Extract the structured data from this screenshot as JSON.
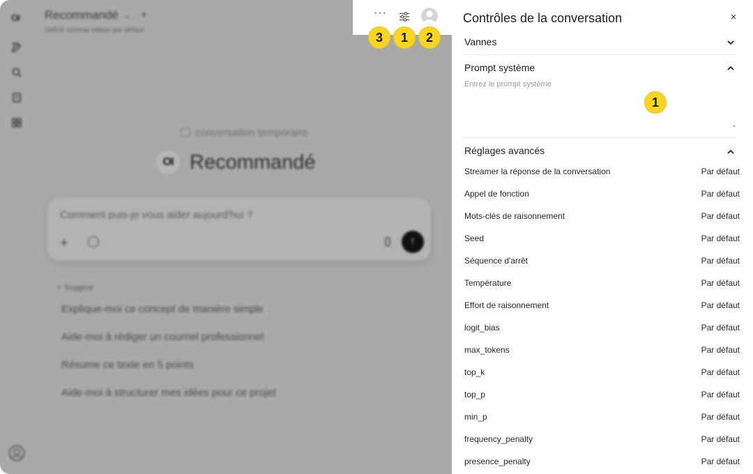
{
  "header": {
    "model_name": "Recommandé",
    "set_default": "Définir comme valeur par défaut"
  },
  "sidebar": {
    "logo": "OI",
    "icons": [
      "new-chat-icon",
      "search-icon",
      "notes-icon",
      "workspace-icon"
    ]
  },
  "chat": {
    "temporary_label": "conversation temporaire",
    "hero_logo": "OI",
    "hero_title": "Recommandé",
    "composer_placeholder": "Comment puis-je vous aider aujourd'hui ?",
    "suggested_heading": "✧ Suggéré",
    "suggestions": [
      "Explique-moi ce concept de manière simple",
      "Aide-moi à rédiger un courriel professionnel",
      "Résume ce texte en 5 points",
      "Aide-moi à structurer mes idées pour ce projet"
    ]
  },
  "toolbar": {
    "more_label": "···"
  },
  "badges": {
    "more": "3",
    "controls": "1",
    "profile": "2",
    "prompt": "1"
  },
  "panel": {
    "title": "Contrôles de la conversation",
    "close": "×",
    "sections": {
      "valves": "Vannes",
      "system_prompt": "Prompt système",
      "advanced": "Réglages avancés"
    },
    "system_prompt_placeholder": "Entrez le prompt système",
    "params": [
      {
        "name": "Streamer la réponse de la conversation",
        "value": "Par défaut"
      },
      {
        "name": "Appel de fonction",
        "value": "Par défaut"
      },
      {
        "name": "Mots-clés de raisonnement",
        "value": "Par défaut"
      },
      {
        "name": "Seed",
        "value": "Par défaut"
      },
      {
        "name": "Séquence d'arrêt",
        "value": "Par défaut"
      },
      {
        "name": "Température",
        "value": "Par défaut"
      },
      {
        "name": "Effort de raisonnement",
        "value": "Par défaut"
      },
      {
        "name": "logit_bias",
        "value": "Par défaut"
      },
      {
        "name": "max_tokens",
        "value": "Par défaut"
      },
      {
        "name": "top_k",
        "value": "Par défaut"
      },
      {
        "name": "top_p",
        "value": "Par défaut"
      },
      {
        "name": "min_p",
        "value": "Par défaut"
      },
      {
        "name": "frequency_penalty",
        "value": "Par défaut"
      },
      {
        "name": "presence_penalty",
        "value": "Par défaut"
      }
    ]
  },
  "colors": {
    "overlay_gray": "#a9a9a9",
    "badge_yellow": "#f9d424",
    "panel_bg": "#ffffff"
  }
}
